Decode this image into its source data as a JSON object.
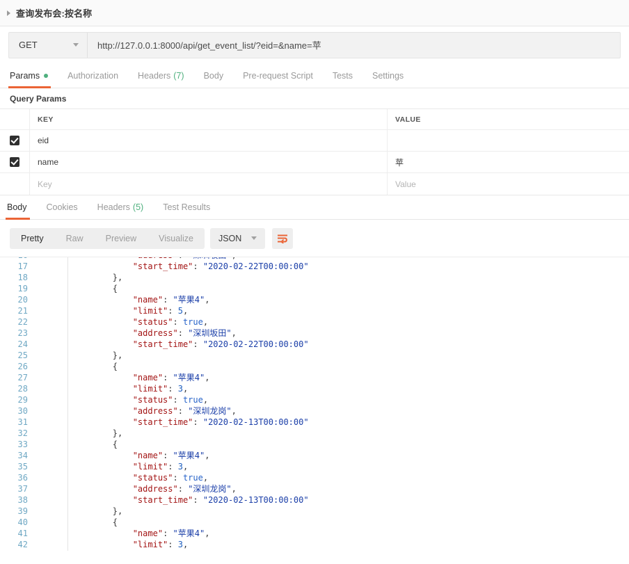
{
  "request": {
    "title": "查询发布会:按名称",
    "collapse_icon": "caret-right-icon",
    "method": "GET",
    "url": "http://127.0.0.1:8000/api/get_event_list/?eid=&name=苹",
    "tabs": [
      {
        "label": "Params",
        "badge": "dot",
        "active": true
      },
      {
        "label": "Authorization",
        "badge": "",
        "active": false
      },
      {
        "label": "Headers",
        "badge": "(7)",
        "active": false
      },
      {
        "label": "Body",
        "badge": "",
        "active": false
      },
      {
        "label": "Pre-request Script",
        "badge": "",
        "active": false
      },
      {
        "label": "Tests",
        "badge": "",
        "active": false
      },
      {
        "label": "Settings",
        "badge": "",
        "active": false
      }
    ]
  },
  "query_params": {
    "section_label": "Query Params",
    "columns": {
      "key": "KEY",
      "value": "VALUE"
    },
    "rows": [
      {
        "checked": true,
        "key": "eid",
        "value": "",
        "key_placeholder": "",
        "value_placeholder": ""
      },
      {
        "checked": true,
        "key": "name",
        "value": "苹",
        "key_placeholder": "",
        "value_placeholder": ""
      },
      {
        "checked": false,
        "key": "",
        "value": "",
        "key_placeholder": "Key",
        "value_placeholder": "Value"
      }
    ]
  },
  "response": {
    "tabs": [
      {
        "label": "Body",
        "badge": "",
        "active": true
      },
      {
        "label": "Cookies",
        "badge": "",
        "active": false
      },
      {
        "label": "Headers",
        "badge": "(5)",
        "active": false
      },
      {
        "label": "Test Results",
        "badge": "",
        "active": false
      }
    ],
    "view_modes": [
      {
        "label": "Pretty",
        "active": true
      },
      {
        "label": "Raw",
        "active": false
      },
      {
        "label": "Preview",
        "active": false
      },
      {
        "label": "Visualize",
        "active": false
      }
    ],
    "format": "JSON",
    "format_caret_icon": "chevron-down-icon",
    "wrap_icon": "wrap-text-icon",
    "accent_color": "#eb6436",
    "body_lines": [
      {
        "num": "16",
        "text": "            \"address\": \"深圳坂田\",",
        "clipped": true
      },
      {
        "num": "17",
        "text": "            \"start_time\": \"2020-02-22T00:00:00\""
      },
      {
        "num": "18",
        "text": "        },"
      },
      {
        "num": "19",
        "text": "        {"
      },
      {
        "num": "20",
        "text": "            \"name\": \"苹果4\","
      },
      {
        "num": "21",
        "text": "            \"limit\": 5,"
      },
      {
        "num": "22",
        "text": "            \"status\": true,"
      },
      {
        "num": "23",
        "text": "            \"address\": \"深圳坂田\","
      },
      {
        "num": "24",
        "text": "            \"start_time\": \"2020-02-22T00:00:00\""
      },
      {
        "num": "25",
        "text": "        },"
      },
      {
        "num": "26",
        "text": "        {"
      },
      {
        "num": "27",
        "text": "            \"name\": \"苹果4\","
      },
      {
        "num": "28",
        "text": "            \"limit\": 3,"
      },
      {
        "num": "29",
        "text": "            \"status\": true,"
      },
      {
        "num": "30",
        "text": "            \"address\": \"深圳龙岗\","
      },
      {
        "num": "31",
        "text": "            \"start_time\": \"2020-02-13T00:00:00\""
      },
      {
        "num": "32",
        "text": "        },"
      },
      {
        "num": "33",
        "text": "        {"
      },
      {
        "num": "34",
        "text": "            \"name\": \"苹果4\","
      },
      {
        "num": "35",
        "text": "            \"limit\": 3,"
      },
      {
        "num": "36",
        "text": "            \"status\": true,"
      },
      {
        "num": "37",
        "text": "            \"address\": \"深圳龙岗\","
      },
      {
        "num": "38",
        "text": "            \"start_time\": \"2020-02-13T00:00:00\""
      },
      {
        "num": "39",
        "text": "        },"
      },
      {
        "num": "40",
        "text": "        {"
      },
      {
        "num": "41",
        "text": "            \"name\": \"苹果4\","
      },
      {
        "num": "42",
        "text": "            \"limit\": 3,"
      }
    ]
  }
}
